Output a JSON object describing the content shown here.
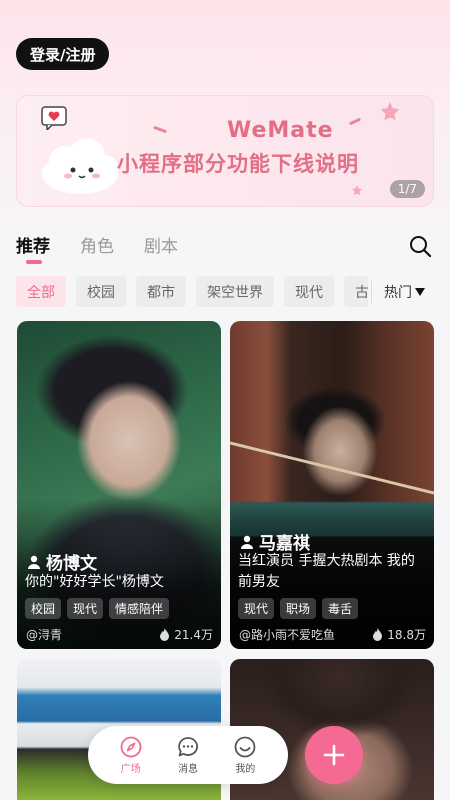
{
  "header": {
    "login_label": "登录/注册"
  },
  "banner": {
    "title_en": "WeMate",
    "title_cn": "小程序部分功能下线说明",
    "counter": "1/7"
  },
  "tabs": [
    {
      "label": "推荐",
      "active": true
    },
    {
      "label": "角色",
      "active": false
    },
    {
      "label": "剧本",
      "active": false
    }
  ],
  "filters": {
    "chips": [
      "全部",
      "校园",
      "都市",
      "架空世界",
      "现代",
      "古风"
    ],
    "active_index": 0,
    "sort_label": "热门"
  },
  "cards": [
    {
      "name": "杨博文",
      "desc": "你的\"好好学长\"杨博文",
      "tags": [
        "校园",
        "现代",
        "情感陪伴"
      ],
      "author": "@浔青",
      "heat": "21.4万"
    },
    {
      "name": "马嘉祺",
      "desc": "当红演员 手握大热剧本 我的前男友",
      "tags": [
        "现代",
        "职场",
        "毒舌"
      ],
      "author": "@路小雨不爱吃鱼",
      "heat": "18.8万"
    },
    {
      "name": "",
      "desc": "",
      "tags": [],
      "author": "",
      "heat": ""
    },
    {
      "name": "",
      "desc": "",
      "tags": [],
      "author": "",
      "heat": ""
    }
  ],
  "bottom_nav": [
    {
      "label": "广场",
      "icon": "compass-icon",
      "active": true
    },
    {
      "label": "消息",
      "icon": "message-icon",
      "active": false
    },
    {
      "label": "我的",
      "icon": "smile-icon",
      "active": false
    }
  ],
  "colors": {
    "accent": "#f06a8c",
    "fab": "#f56a93"
  }
}
